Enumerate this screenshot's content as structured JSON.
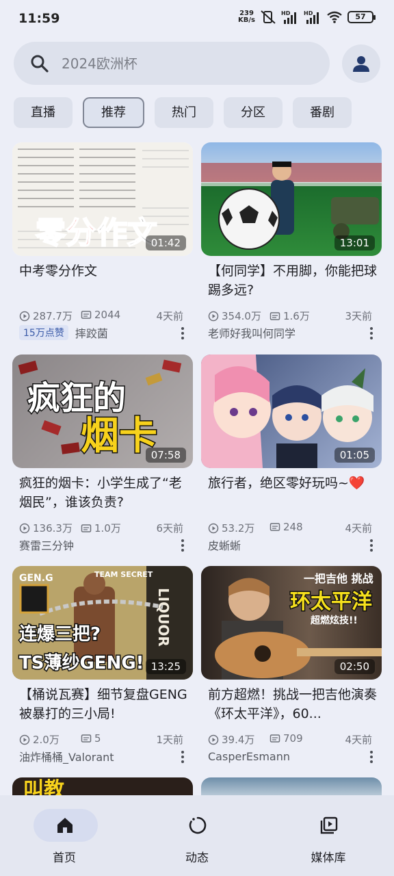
{
  "status_bar": {
    "time": "11:59",
    "speed": "239",
    "speed_unit": "KB/s",
    "battery": "57"
  },
  "search": {
    "placeholder": "2024欧洲杯"
  },
  "chips": [
    {
      "label": "直播"
    },
    {
      "label": "推荐"
    },
    {
      "label": "热门"
    },
    {
      "label": "分区"
    },
    {
      "label": "番剧"
    }
  ],
  "videos": [
    {
      "title": "中考零分作文",
      "duration": "01:42",
      "views": "287.7万",
      "danmaku": "2044",
      "age": "4天前",
      "badge": "15万点赞",
      "author": "摔跤菌",
      "thumb_text": "零分作文"
    },
    {
      "title": "【何同学】不用脚，你能把球踢多远?",
      "duration": "13:01",
      "views": "354.0万",
      "danmaku": "1.6万",
      "age": "3天前",
      "author": "老师好我叫何同学"
    },
    {
      "title": "疯狂的烟卡：小学生成了“老烟民”，谁该负责?",
      "duration": "07:58",
      "views": "136.3万",
      "danmaku": "1.0万",
      "age": "6天前",
      "author": "赛雷三分钟",
      "thumb_text_1": "疯狂的",
      "thumb_text_2": "烟卡"
    },
    {
      "title": "旅行者，绝区零好玩吗~❤️",
      "duration": "01:05",
      "views": "53.2万",
      "danmaku": "248",
      "age": "4天前",
      "author": "皮蜥蜥"
    },
    {
      "title": "【桶说瓦赛】细节复盘GENG被暴打的三小局!",
      "duration": "13:25",
      "views": "2.0万",
      "danmaku": "5",
      "age": "1天前",
      "author": "油炸桶桶_Valorant",
      "thumb_text_1": "连爆三把?",
      "thumb_text_2": "TS薄纱GENG!",
      "thumb_logo_1": "GEN.G",
      "thumb_logo_2": "TEAM SECRET",
      "thumb_sign": "LIQUOR"
    },
    {
      "title": "前方超燃！挑战一把吉他演奏《环太平洋》，60...",
      "duration": "02:50",
      "views": "39.4万",
      "danmaku": "709",
      "age": "4天前",
      "author": "CasperEsmann",
      "thumb_text_1": "一把吉他 挑战",
      "thumb_text_2": "环太平洋",
      "thumb_text_3": "超燃炫技!!"
    },
    {
      "thumb_text": "叫教"
    },
    {}
  ],
  "nav": [
    {
      "label": "首页",
      "icon": "home-icon"
    },
    {
      "label": "动态",
      "icon": "activity-icon"
    },
    {
      "label": "媒体库",
      "icon": "media-library-icon"
    }
  ],
  "colors": {
    "background": "#eceef7",
    "search_bg": "#dde1ec",
    "nav_active": "#d6dcef",
    "badge_text": "#3a5aa8",
    "heart": "#e0302c"
  }
}
